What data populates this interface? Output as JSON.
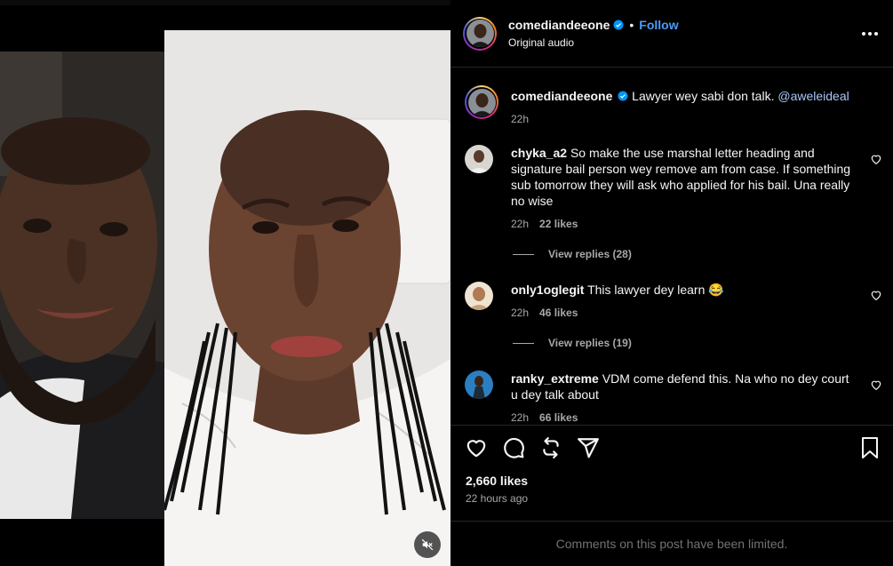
{
  "post": {
    "username": "comediandeeone",
    "follow_label": "Follow",
    "separator": "•",
    "audio_label": "Original audio"
  },
  "caption": {
    "username": "comediandeeone",
    "text": "Lawyer wey sabi don talk.",
    "mention": "@aweleideal",
    "time": "22h"
  },
  "comments": [
    {
      "username": "chyka_a2",
      "text": "So make the use marshal letter heading and signature bail person wey remove am from case. If something sub tomorrow they will ask who applied for his bail. Una really no wise",
      "time": "22h",
      "likes": "22 likes",
      "replies": "View replies (28)"
    },
    {
      "username": "only1oglegit",
      "text": "This lawyer dey learn 😂",
      "time": "22h",
      "likes": "46 likes",
      "replies": "View replies (19)"
    },
    {
      "username": "ranky_extreme",
      "text": "VDM come defend this. Na who no dey court u dey talk about",
      "time": "22h",
      "likes": "66 likes"
    }
  ],
  "stats": {
    "likes": "2,660 likes",
    "time_ago": "22 hours ago"
  },
  "footer": {
    "limited_text": "Comments on this post have been limited."
  },
  "icons": {
    "verified": "verified-badge-icon",
    "more": "more-options-icon",
    "like": "heart-icon",
    "comment": "comment-bubble-icon",
    "repost": "repost-icon",
    "share": "share-paper-plane-icon",
    "save": "bookmark-icon",
    "mute": "muted-speaker-icon"
  },
  "colors": {
    "accent_link": "#4a9df8",
    "mention": "#a8c7fa",
    "verified": "#0095f6",
    "background": "#000000",
    "muted_text": "#a8a8a8"
  }
}
